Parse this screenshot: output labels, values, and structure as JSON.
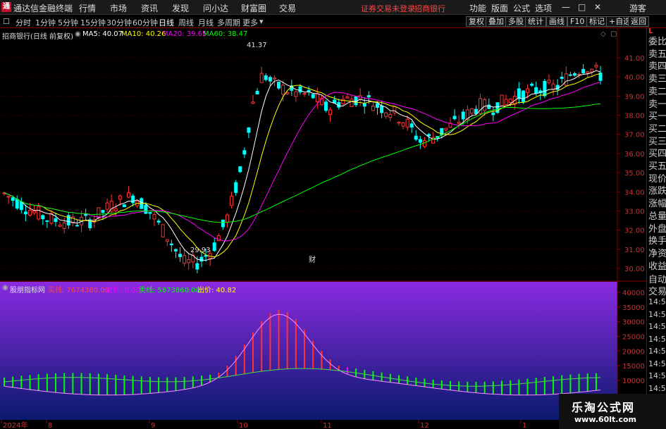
{
  "menubar": {
    "logo": "通",
    "app_title": "通达信金融终端",
    "items": [
      "行情",
      "市场",
      "资讯",
      "发现",
      "问小达",
      "财富圈",
      "交易"
    ],
    "login_warning": "证券交易未登录",
    "stock_name": "招商银行",
    "right_items": [
      "功能",
      "版面",
      "公式",
      "选项"
    ],
    "guest": "游客"
  },
  "toolbar": {
    "periods": [
      "分时",
      "1分钟",
      "5分钟",
      "15分钟",
      "30分钟",
      "60分钟",
      "日线",
      "周线",
      "月线",
      "多周期",
      "更多"
    ],
    "active": "日线",
    "right_buttons": [
      "复权",
      "叠加",
      "多股",
      "统计",
      "画线",
      "F10",
      "标记",
      "+自选",
      "返回"
    ]
  },
  "main_chart": {
    "title": "招商银行(日线 前复权)",
    "ma": [
      {
        "label": "MA5: 40.07",
        "color": "#ffffff"
      },
      {
        "label": "MA10: 40.26",
        "color": "#ffff00"
      },
      {
        "label": "MA20: 39.65",
        "color": "#ff00ff"
      },
      {
        "label": "MA60: 38.47",
        "color": "#00ff00"
      }
    ],
    "high_label": "41.37",
    "low_label": "29.93",
    "finance_marker": "财",
    "yticks": [
      "41.00",
      "40.00",
      "39.00",
      "38.00",
      "37.00",
      "36.00",
      "35.00",
      "34.00",
      "33.00",
      "32.00",
      "31.00",
      "30.00"
    ]
  },
  "sub_chart": {
    "title": "股朋指标网",
    "fields": [
      {
        "label": "买线: 7674380.00",
        "color": "#ff4444"
      },
      {
        "label": "进价: 0.00",
        "color": "#ff00ff"
      },
      {
        "label": "卖线: 5873860.00",
        "color": "#00ff00"
      },
      {
        "label": "出价: 40.82",
        "color": "#ffff00"
      }
    ],
    "yticks": [
      "40000",
      "35000",
      "30000",
      "25000",
      "20000",
      "15000",
      "10000"
    ]
  },
  "xaxis": {
    "labels": [
      "2024年",
      "8",
      "9",
      "10",
      "11",
      "12",
      "1"
    ]
  },
  "side_panel": {
    "top_label": "L",
    "items": [
      "委比",
      "卖五",
      "卖四",
      "卖三",
      "卖二",
      "卖一",
      "买一",
      "买二",
      "买三",
      "买四",
      "买五",
      "现价",
      "涨跌",
      "涨幅",
      "总量",
      "外盘",
      "换手",
      "净资",
      "收益"
    ],
    "lower_items": [
      "自动",
      "交易"
    ],
    "times": [
      "14:5",
      "14:5",
      "14:5",
      "14:5",
      "14:5",
      "14:5",
      "14:5",
      "14:5"
    ]
  },
  "watermark": {
    "line1": "乐淘公式网",
    "line2": "www.60lt.com"
  },
  "colors": {
    "up": "#ff3232",
    "down": "#00ffff",
    "ma5": "#ffffff",
    "ma10": "#ffff00",
    "ma20": "#ff00ff",
    "ma60": "#00ff00",
    "grid": "#8b0000"
  }
}
